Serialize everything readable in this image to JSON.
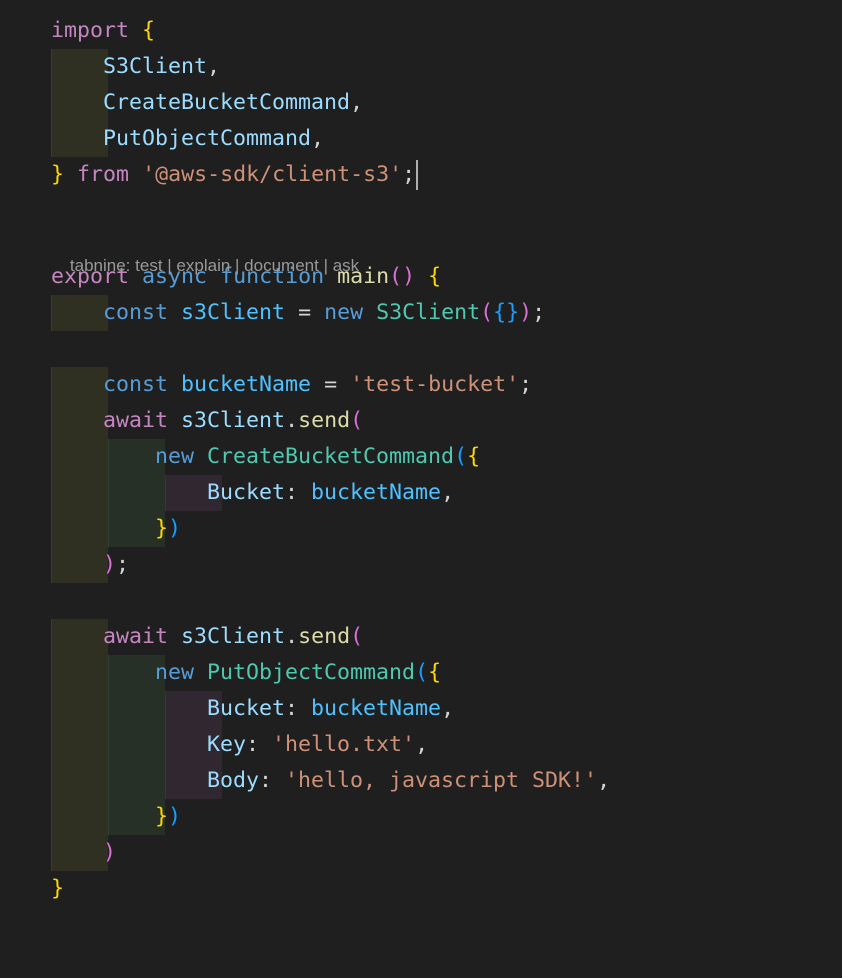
{
  "editor": {
    "codelens": {
      "prefix": "tabnine: ",
      "actions": [
        "test",
        "explain",
        "document",
        "ask"
      ],
      "separator": " | "
    },
    "lines": [
      [
        [
          "kw",
          "import"
        ],
        [
          "pl",
          " "
        ],
        [
          "b1",
          "{"
        ]
      ],
      [
        [
          "pl",
          "    "
        ],
        [
          "vr",
          "S3Client"
        ],
        [
          "pl",
          ","
        ]
      ],
      [
        [
          "pl",
          "    "
        ],
        [
          "vr",
          "CreateBucketCommand"
        ],
        [
          "pl",
          ","
        ]
      ],
      [
        [
          "pl",
          "    "
        ],
        [
          "vr",
          "PutObjectCommand"
        ],
        [
          "pl",
          ","
        ]
      ],
      [
        [
          "b1",
          "}"
        ],
        [
          "pl",
          " "
        ],
        [
          "kw",
          "from"
        ],
        [
          "pl",
          " "
        ],
        [
          "str",
          "'@aws-sdk/client-s3'"
        ],
        [
          "pl",
          ";"
        ]
      ],
      [],
      [],
      [
        [
          "kw",
          "export"
        ],
        [
          "pl",
          " "
        ],
        [
          "st",
          "async"
        ],
        [
          "pl",
          " "
        ],
        [
          "st",
          "function"
        ],
        [
          "pl",
          " "
        ],
        [
          "fn",
          "main"
        ],
        [
          "b2",
          "()"
        ],
        [
          "pl",
          " "
        ],
        [
          "b1",
          "{"
        ]
      ],
      [
        [
          "pl",
          "    "
        ],
        [
          "st",
          "const"
        ],
        [
          "pl",
          " "
        ],
        [
          "cv",
          "s3Client"
        ],
        [
          "pl",
          " = "
        ],
        [
          "st",
          "new"
        ],
        [
          "pl",
          " "
        ],
        [
          "ty",
          "S3Client"
        ],
        [
          "b2",
          "("
        ],
        [
          "b3",
          "{}"
        ],
        [
          "b2",
          ")"
        ],
        [
          "pl",
          ";"
        ]
      ],
      [],
      [
        [
          "pl",
          "    "
        ],
        [
          "st",
          "const"
        ],
        [
          "pl",
          " "
        ],
        [
          "cv",
          "bucketName"
        ],
        [
          "pl",
          " = "
        ],
        [
          "str",
          "'test-bucket'"
        ],
        [
          "pl",
          ";"
        ]
      ],
      [
        [
          "pl",
          "    "
        ],
        [
          "kw",
          "await"
        ],
        [
          "pl",
          " "
        ],
        [
          "vr",
          "s3Client"
        ],
        [
          "pl",
          "."
        ],
        [
          "fn",
          "send"
        ],
        [
          "b2",
          "("
        ]
      ],
      [
        [
          "pl",
          "        "
        ],
        [
          "st",
          "new"
        ],
        [
          "pl",
          " "
        ],
        [
          "ty",
          "CreateBucketCommand"
        ],
        [
          "b3",
          "("
        ],
        [
          "b1",
          "{"
        ]
      ],
      [
        [
          "pl",
          "            "
        ],
        [
          "vr",
          "Bucket"
        ],
        [
          "pl",
          ": "
        ],
        [
          "cv",
          "bucketName"
        ],
        [
          "pl",
          ","
        ]
      ],
      [
        [
          "pl",
          "        "
        ],
        [
          "b1",
          "}"
        ],
        [
          "b3",
          ")"
        ]
      ],
      [
        [
          "pl",
          "    "
        ],
        [
          "b2",
          ")"
        ],
        [
          "pl",
          ";"
        ]
      ],
      [],
      [
        [
          "pl",
          "    "
        ],
        [
          "kw",
          "await"
        ],
        [
          "pl",
          " "
        ],
        [
          "vr",
          "s3Client"
        ],
        [
          "pl",
          "."
        ],
        [
          "fn",
          "send"
        ],
        [
          "b2",
          "("
        ]
      ],
      [
        [
          "pl",
          "        "
        ],
        [
          "st",
          "new"
        ],
        [
          "pl",
          " "
        ],
        [
          "ty",
          "PutObjectCommand"
        ],
        [
          "b3",
          "("
        ],
        [
          "b1",
          "{"
        ]
      ],
      [
        [
          "pl",
          "            "
        ],
        [
          "vr",
          "Bucket"
        ],
        [
          "pl",
          ": "
        ],
        [
          "cv",
          "bucketName"
        ],
        [
          "pl",
          ","
        ]
      ],
      [
        [
          "pl",
          "            "
        ],
        [
          "vr",
          "Key"
        ],
        [
          "pl",
          ": "
        ],
        [
          "str",
          "'hello.txt'"
        ],
        [
          "pl",
          ","
        ]
      ],
      [
        [
          "pl",
          "            "
        ],
        [
          "vr",
          "Body"
        ],
        [
          "pl",
          ": "
        ],
        [
          "str",
          "'hello, javascript SDK!'"
        ],
        [
          "pl",
          ","
        ]
      ],
      [
        [
          "pl",
          "        "
        ],
        [
          "b1",
          "}"
        ],
        [
          "b3",
          ")"
        ]
      ],
      [
        [
          "pl",
          "    "
        ],
        [
          "b2",
          ")"
        ]
      ],
      [
        [
          "b1",
          "}"
        ]
      ]
    ],
    "colors": {
      "background": "#1f1f1f",
      "keyword_control": "#c586c0",
      "keyword_storage": "#569cd6",
      "type": "#4ec9b0",
      "variable": "#9cdcfe",
      "constant": "#4fc1ff",
      "function": "#dcdcaa",
      "string": "#ce9178",
      "bracket_level_1": "#ffd700",
      "bracket_level_2": "#da70d6",
      "bracket_level_3": "#179fff"
    }
  }
}
